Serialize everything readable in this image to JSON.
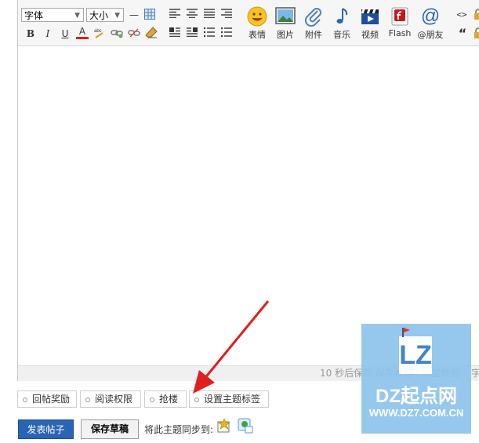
{
  "toolbar": {
    "font_select": "字体",
    "size_select": "大小",
    "format_icons": [
      "bold-icon",
      "italic-icon",
      "underline-icon",
      "font-color-icon",
      "spellcheck-icon",
      "link-icon",
      "unlink-icon",
      "clear-format-icon"
    ],
    "bold_glyph": "B",
    "italic_glyph": "I",
    "underline_glyph": "U",
    "color_glyph": "A",
    "align_icons": [
      "align-left-icon",
      "align-center-icon",
      "align-justify-icon",
      "align-right-icon"
    ],
    "buttons": [
      {
        "label": "表情",
        "icon": "smiley-icon"
      },
      {
        "label": "图片",
        "icon": "image-icon"
      },
      {
        "label": "附件",
        "icon": "paperclip-icon"
      },
      {
        "label": "音乐",
        "icon": "music-note-icon"
      },
      {
        "label": "视频",
        "icon": "video-icon"
      },
      {
        "label": "Flash",
        "icon": "flash-icon"
      },
      {
        "label": "@朋友",
        "icon": "at-icon"
      }
    ],
    "code_glyph": "<>",
    "quote_glyph": "“"
  },
  "statusbar": {
    "autosave_text": "10 秒后保存 保存数据 | 恢复数据",
    "char_count": "字"
  },
  "options": {
    "tabs": [
      "回帖奖励",
      "阅读权限",
      "抢楼",
      "设置主题标签"
    ]
  },
  "actions": {
    "publish_label": "发表帖子",
    "save_draft_label": "保存草稿",
    "sync_label": "将此主题同步到:"
  },
  "watermark": {
    "logo_text": "LZ",
    "brand_text": "DZ起点网",
    "url_text": "WWW.DZ7.COM.CN"
  },
  "colors": {
    "primary_button": "#2a64b4",
    "arrow": "#e0201e",
    "watermark_bg": "#8ec3ec"
  }
}
